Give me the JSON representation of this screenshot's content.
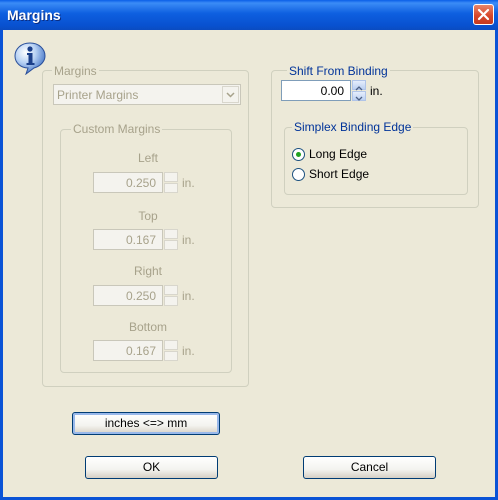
{
  "window": {
    "title": "Margins"
  },
  "left": {
    "group_label": "Margins",
    "preset_select": "Printer Margins",
    "custom": {
      "group_label": "Custom Margins",
      "unit": "in.",
      "fields": [
        {
          "label": "Left",
          "value": "0.250"
        },
        {
          "label": "Top",
          "value": "0.167"
        },
        {
          "label": "Right",
          "value": "0.250"
        },
        {
          "label": "Bottom",
          "value": "0.167"
        }
      ]
    }
  },
  "right": {
    "shift_group_label": "Shift From Binding",
    "shift_value": "0.00",
    "shift_unit": "in.",
    "simplex_group_label": "Simplex Binding Edge",
    "options": [
      {
        "label": "Long Edge",
        "selected": true
      },
      {
        "label": "Short Edge",
        "selected": false
      }
    ]
  },
  "buttons": {
    "convert": "inches <=> mm",
    "ok": "OK",
    "cancel": "Cancel"
  },
  "icons": {
    "close": "close-icon",
    "info": "info-icon"
  }
}
